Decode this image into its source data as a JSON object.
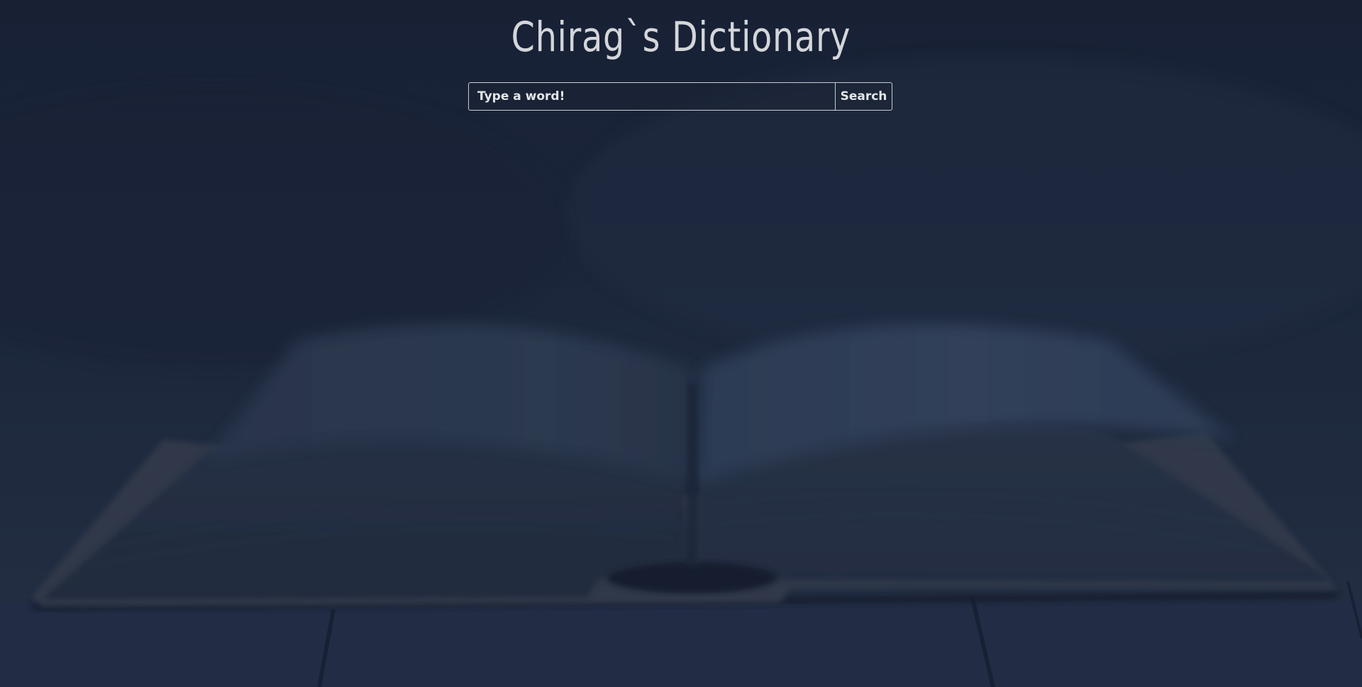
{
  "page": {
    "title": "Chirag`s Dictionary"
  },
  "search": {
    "placeholder": "Type a word!",
    "value": "",
    "button_label": "Search"
  },
  "colors": {
    "overlay": "#1c2536",
    "text": "#d4d6da",
    "border": "#c9ccd2"
  },
  "background": {
    "image": "open-book-on-wooden-table"
  }
}
